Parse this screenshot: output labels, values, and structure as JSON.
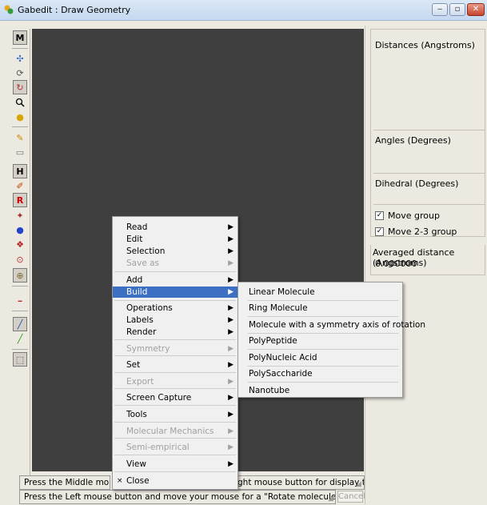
{
  "window": {
    "title": "Gabedit : Draw Geometry",
    "buttons": {
      "minimize": "‒",
      "maximize": "▫",
      "close": "✕"
    }
  },
  "toolbar": {
    "mode_label": "M",
    "tools": [
      {
        "name": "translate-icon",
        "glyph": "✣"
      },
      {
        "name": "rotate-icon",
        "glyph": "⟳"
      },
      {
        "name": "rotate-z-icon",
        "glyph": "↻"
      },
      {
        "name": "zoom-icon",
        "glyph": "🔍"
      },
      {
        "name": "scale-icon",
        "glyph": "●"
      },
      {
        "name": "pencil-icon",
        "glyph": "✎"
      },
      {
        "name": "select-icon",
        "glyph": "▭"
      },
      {
        "name": "hydrogen-icon",
        "glyph": "H"
      },
      {
        "name": "edit-icon",
        "glyph": "✐"
      },
      {
        "name": "residue-icon",
        "glyph": "R"
      },
      {
        "name": "fragment-icon",
        "glyph": "✦"
      },
      {
        "name": "atom-icon",
        "glyph": "●"
      },
      {
        "name": "insert-icon",
        "glyph": "❖"
      },
      {
        "name": "measure-icon",
        "glyph": "⊙"
      },
      {
        "name": "delete-icon",
        "glyph": "⊕"
      },
      {
        "name": "bond-icon",
        "glyph": "━"
      },
      {
        "name": "line-icon",
        "glyph": "╱"
      },
      {
        "name": "bond-color-icon",
        "glyph": "╱"
      },
      {
        "name": "frame-icon",
        "glyph": "⬚"
      }
    ]
  },
  "panel": {
    "distances_label": "Distances (Angstroms)",
    "angles_label": "Angles (Degrees)",
    "dihedral_label": "Dihedral (Degrees)",
    "move_group_label": "Move group",
    "move_23_group_label": "Move 2-3 group",
    "check_mark": "✓",
    "averaged_label": "Averaged distance (Angstroms)",
    "averaged_value": "0.000000"
  },
  "status": {
    "line1_left": "Press the Middle mouse bu",
    "line1_right": "ght mouse button for display the ...",
    "line2": "Press the Left mouse button and move your mouse for a \"Rotate molecule about z axis\".",
    "cancel_label": "Cancel"
  },
  "context_menu": {
    "arrow": "▶",
    "items": [
      {
        "label": "Read",
        "has_sub": true,
        "disabled": false
      },
      {
        "label": "Edit",
        "has_sub": true,
        "disabled": false
      },
      {
        "label": "Selection",
        "has_sub": true,
        "disabled": false
      },
      {
        "label": "Save as",
        "has_sub": true,
        "disabled": true
      },
      {
        "label": "Add",
        "has_sub": true,
        "disabled": false
      },
      {
        "label": "Build",
        "has_sub": true,
        "disabled": false,
        "active": true
      },
      {
        "label": "Operations",
        "has_sub": true,
        "disabled": false
      },
      {
        "label": "Labels",
        "has_sub": true,
        "disabled": false
      },
      {
        "label": "Render",
        "has_sub": true,
        "disabled": false
      },
      {
        "label": "Symmetry",
        "has_sub": true,
        "disabled": true
      },
      {
        "label": "Set",
        "has_sub": true,
        "disabled": false
      },
      {
        "label": "Export",
        "has_sub": true,
        "disabled": true
      },
      {
        "label": "Screen Capture",
        "has_sub": true,
        "disabled": false
      },
      {
        "label": "Tools",
        "has_sub": true,
        "disabled": false
      },
      {
        "label": "Molecular Mechanics",
        "has_sub": true,
        "disabled": true
      },
      {
        "label": "Semi-empirical",
        "has_sub": true,
        "disabled": true
      },
      {
        "label": "View",
        "has_sub": true,
        "disabled": false
      },
      {
        "label": "Close",
        "has_sub": false,
        "disabled": false,
        "icon": "×"
      }
    ]
  },
  "build_submenu": {
    "items": [
      "Linear Molecule",
      "Ring Molecule",
      "Molecule with a symmetry axis of rotation",
      "PolyPeptide",
      "PolyNucleic Acid",
      "PolySaccharide",
      "Nanotube"
    ]
  },
  "colors": {
    "canvas": "#3f3f3f",
    "menu_highlight": "#3d6fc2",
    "titlebar": "#c4d8ef"
  }
}
